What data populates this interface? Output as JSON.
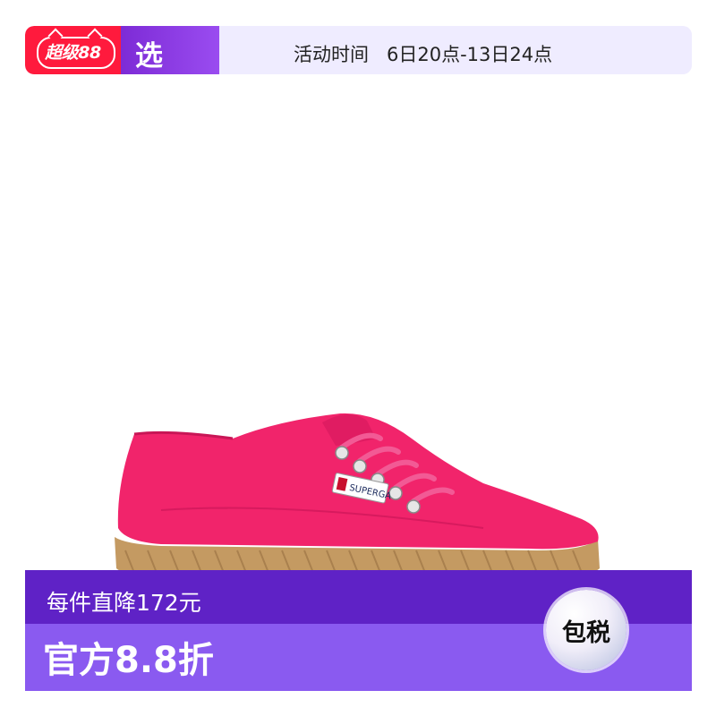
{
  "promo_bar": {
    "logo_text": "超级88",
    "select_label": "选",
    "activity_time": "活动时间   6日20点-13日24点"
  },
  "product": {
    "brand_label": "SUPERGA",
    "colors": {
      "canvas": "#f1246b",
      "sole": "#c49a62",
      "eyelet": "#d9d9d9"
    }
  },
  "price_banner": {
    "discount_text": "每件直降172元",
    "main_offer": "官方8.8折",
    "tax_badge": "包税",
    "colors": {
      "top": "#5f22c6",
      "bottom": "#8a5af0"
    }
  },
  "colors": {
    "accent_red": "#ff1a3d",
    "accent_purple": "#7d2bd6",
    "bar_bg": "#efecff"
  }
}
